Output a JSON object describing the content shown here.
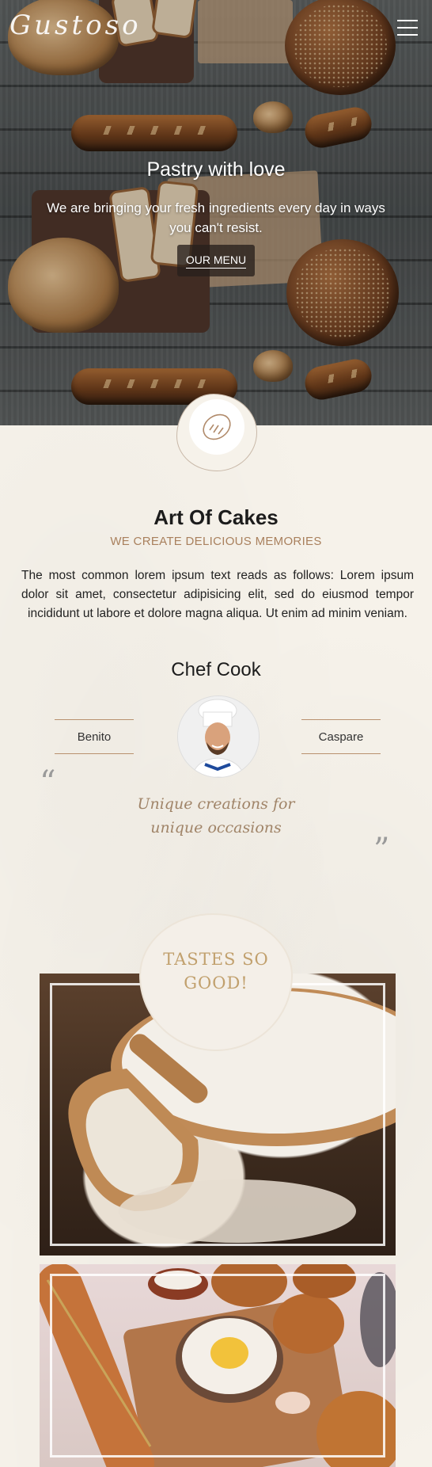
{
  "header": {
    "logo_text": "Gustoso",
    "menu_icon": "hamburger-icon"
  },
  "hero": {
    "title": "Pastry with love",
    "subtitle": "We are bringing your fresh ingredients every day in ways you can't resist.",
    "cta_label": "OUR MENU",
    "badge_icon": "bread-icon"
  },
  "about": {
    "title": "Art Of Cakes",
    "subtitle": "WE CREATE DELICIOUS MEMORIES",
    "body": "The most common lorem ipsum text reads as follows: Lorem ipsum dolor sit amet, consectetur adipisicing elit, sed do eiusmod tempor incididunt ut labore et dolore magna aliqua. Ut enim ad minim veniam."
  },
  "chef": {
    "title": "Chef Cook",
    "left_name": "Benito",
    "right_name": "Caspare",
    "avatar_icon": "chef-avatar"
  },
  "quote": {
    "open_mark": "“",
    "close_mark": "”",
    "text": "Unique creations for unique occasions"
  },
  "gallery": {
    "badge_text": "TASTES SO GOOD!",
    "images": [
      "flour-scoop-photo",
      "bakery-ingredients-photo"
    ]
  },
  "colors": {
    "accent": "#a9805d",
    "background": "#f6f2ea",
    "badge_text": "#c1a06d"
  }
}
